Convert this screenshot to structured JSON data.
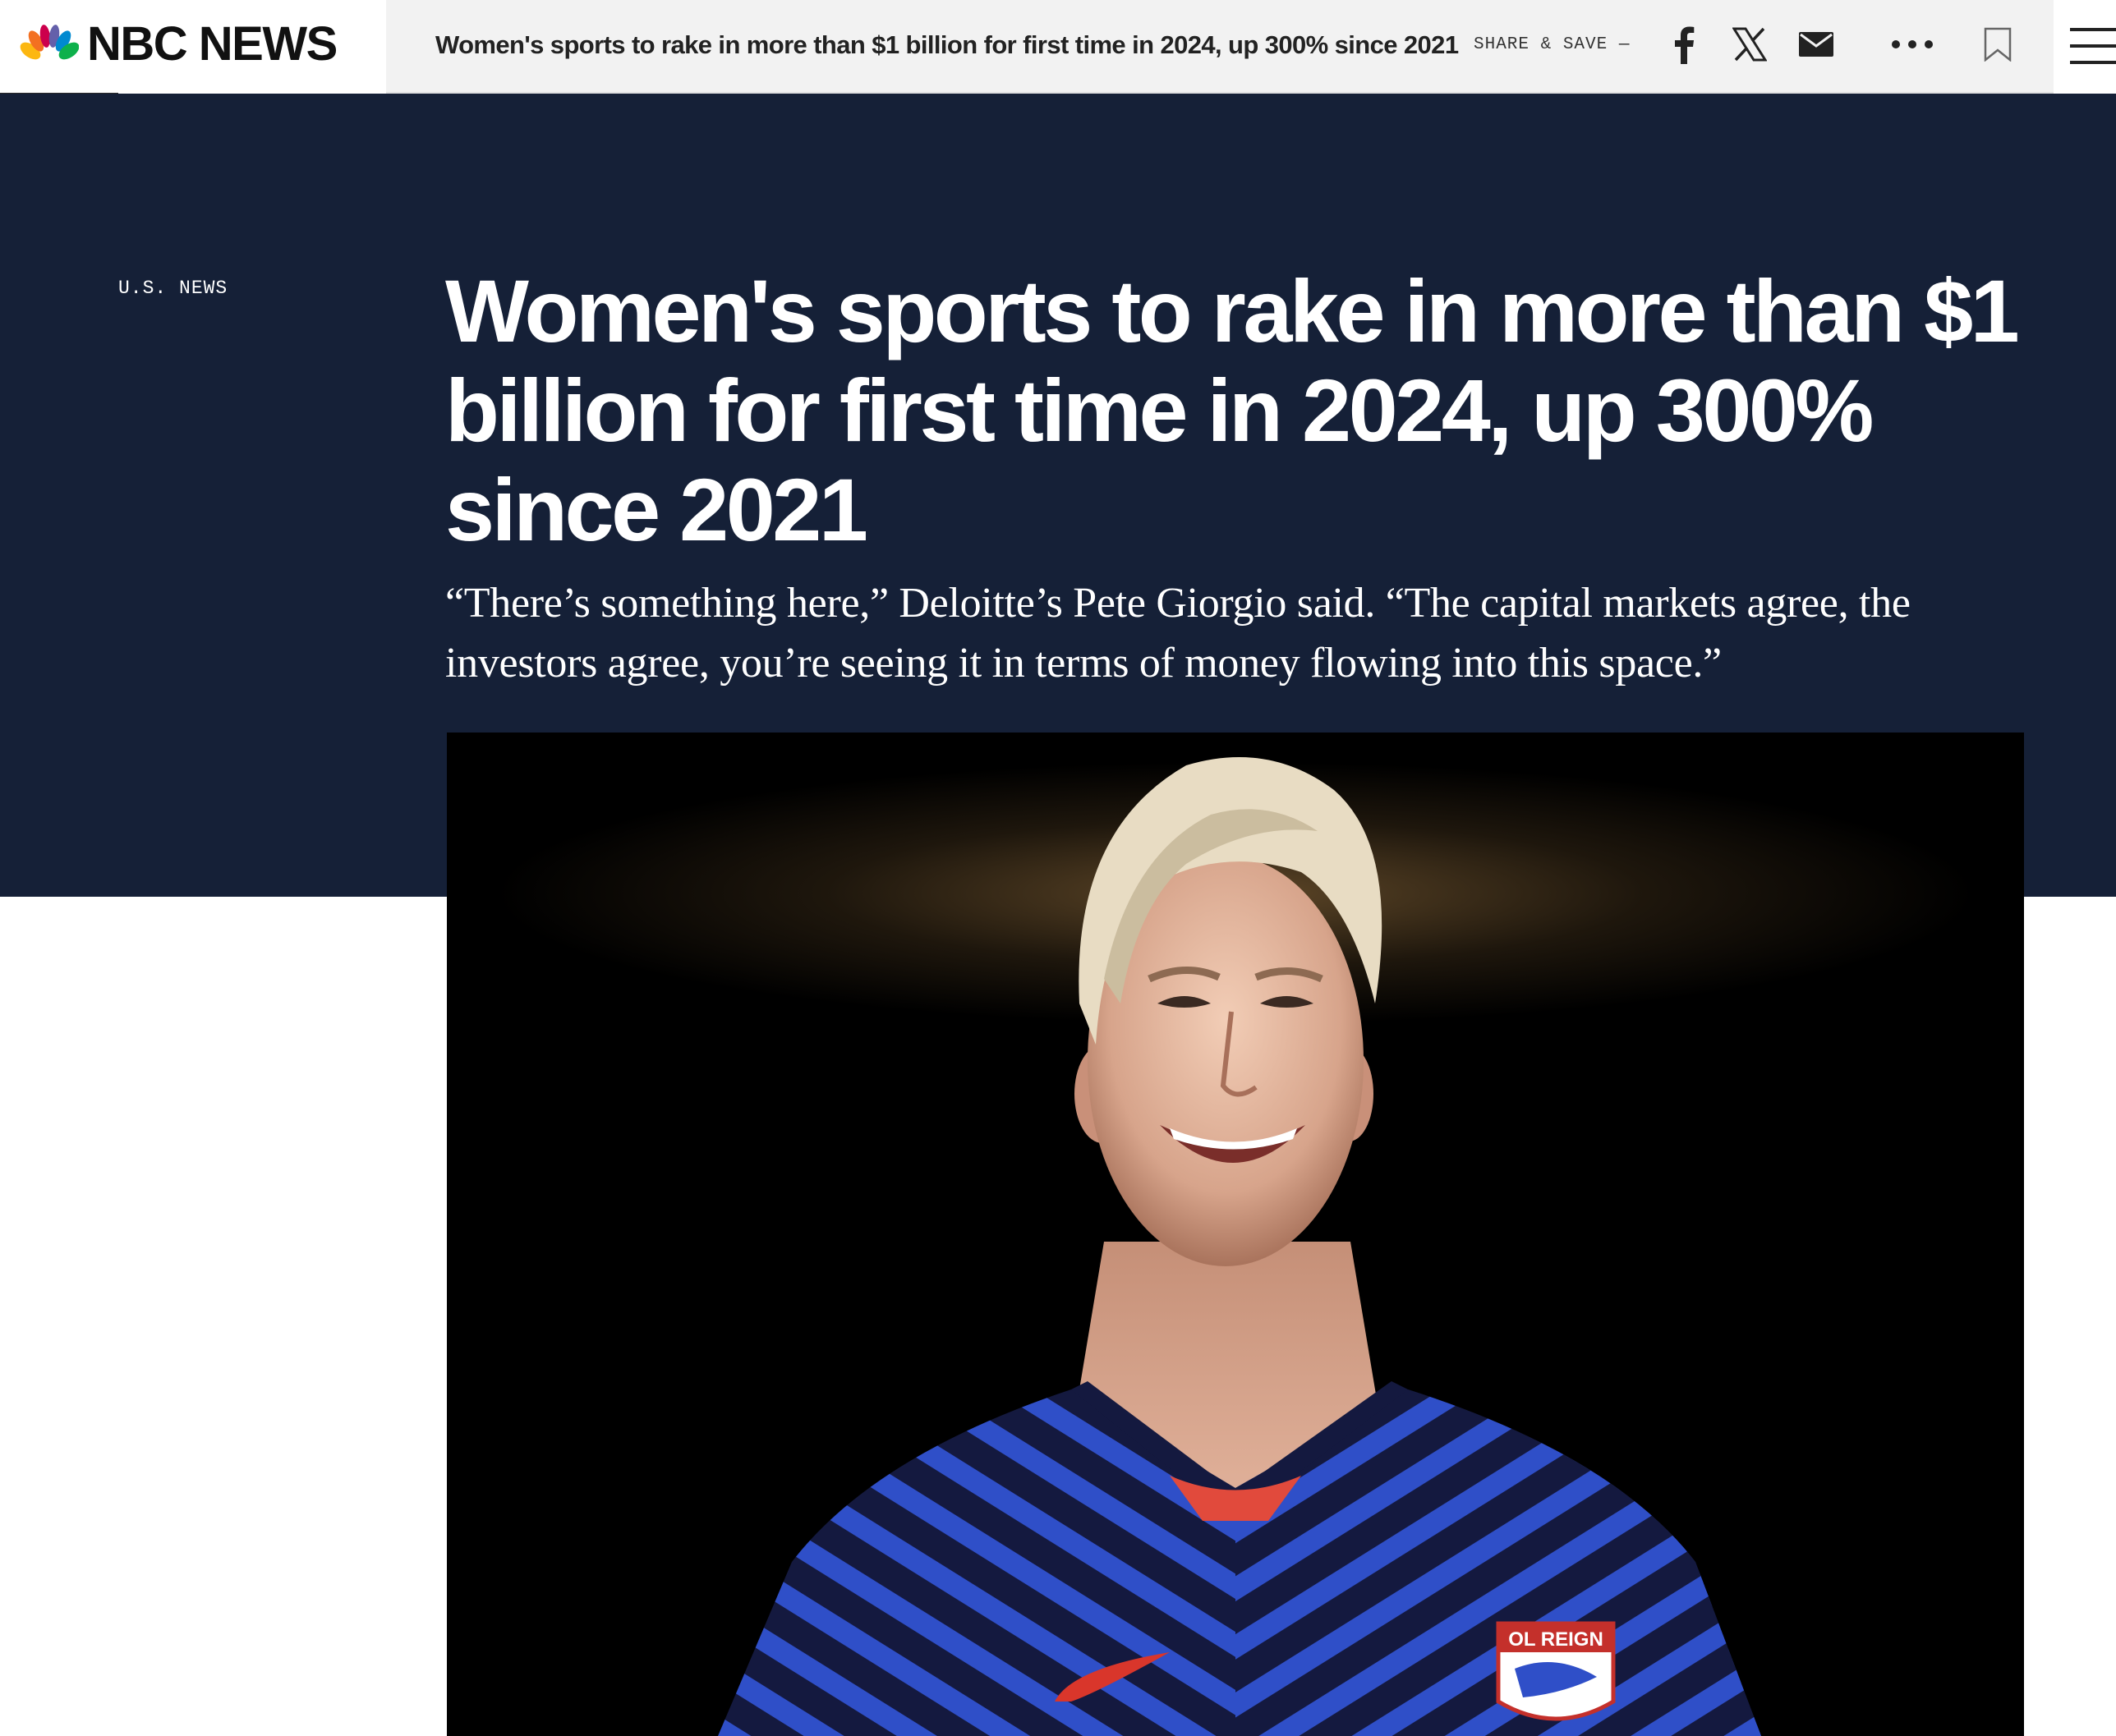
{
  "brand": {
    "name": "NBC NEWS",
    "peacock_colors": [
      "#f37021",
      "#fcb711",
      "#cc004c",
      "#6460aa",
      "#0089d0",
      "#0db14b"
    ]
  },
  "header": {
    "title": "Women's sports to rake in more than $1 billion for first time in 2024, up 300% since 2021",
    "share_save_label": "SHARE & SAVE —",
    "icons": [
      "facebook-icon",
      "x-icon",
      "email-icon",
      "more-icon",
      "bookmark-icon",
      "menu-icon"
    ]
  },
  "article": {
    "section": "U.S. NEWS",
    "headline": "Women's sports to rake in more than $1 billion for first time in 2024, up 300% since 2021",
    "dek": "“There’s something here,” Deloitte’s Pete Giorgio said. “The capital markets agree, the investors agree, you’re seeing it in terms of money flowing into this space.”"
  },
  "photo": {
    "jersey_badge_text": "OL REIGN"
  },
  "colors": {
    "hero_background": "#152037",
    "header_background": "#f2f2f2",
    "text_on_dark": "#ffffff"
  }
}
